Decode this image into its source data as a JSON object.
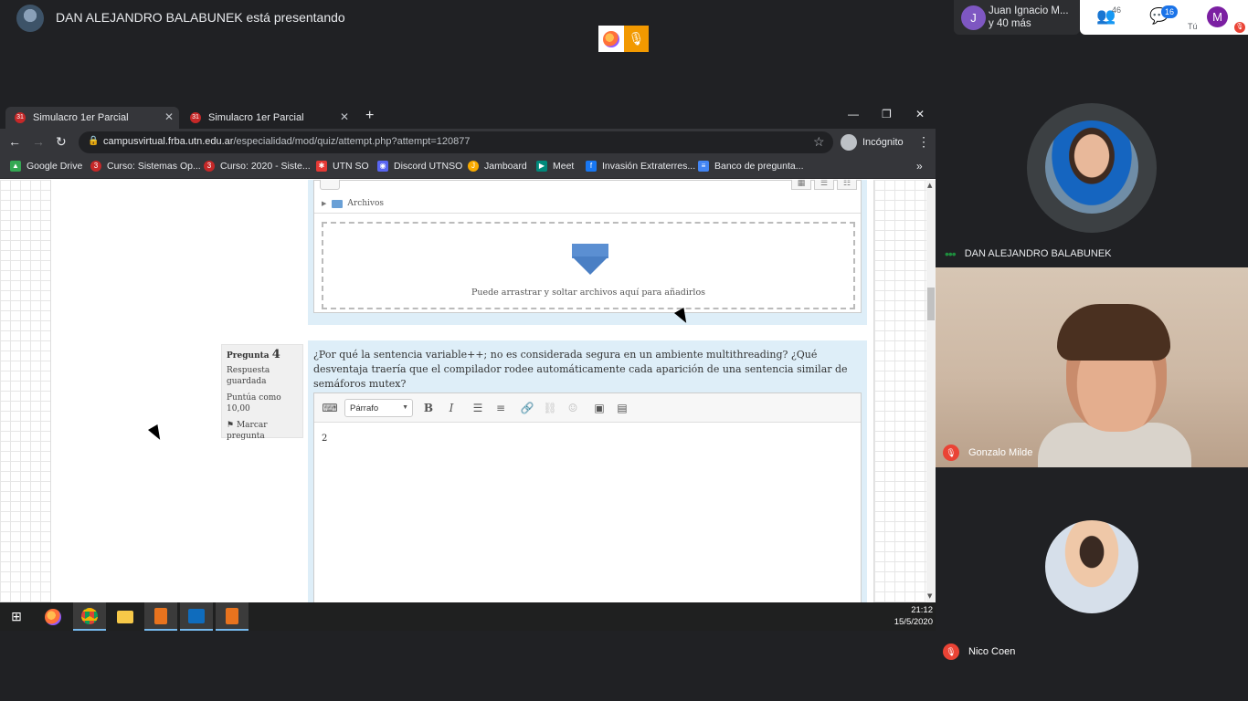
{
  "meet": {
    "presenter_text": "DAN ALEJANDRO BALABUNEK está presentando",
    "joined_avatar_initial": "J",
    "joined_line1": "Juan Ignacio M...",
    "joined_line2": "y 40 más",
    "people_count": "46",
    "chat_count": "16",
    "me_initial": "M",
    "me_label": "Tú",
    "icons": [
      "presentation-avatar",
      "firefox-icon",
      "microphone-icon",
      "people-icon",
      "chat-icon",
      "mute-icon"
    ]
  },
  "browser": {
    "tabs": [
      {
        "label": "Simulacro 1er Parcial",
        "active": true
      },
      {
        "label": "Simulacro 1er Parcial",
        "active": false
      }
    ],
    "url_host": "campusvirtual.frba.utn.edu.ar",
    "url_path": "/especialidad/mod/quiz/attempt.php?attempt=120877",
    "incognito_label": "Incógnito",
    "bookmarks": [
      {
        "label": "Google Drive",
        "color": "#34a853"
      },
      {
        "label": "Curso: Sistemas Op...",
        "color": "#c62828"
      },
      {
        "label": "Curso: 2020 - Siste...",
        "color": "#c62828"
      },
      {
        "label": "UTN SO",
        "color": "#e53935"
      },
      {
        "label": "Discord UTNSO",
        "color": "#5865f2"
      },
      {
        "label": "Jamboard",
        "color": "#f9ab00"
      },
      {
        "label": "Meet",
        "color": "#00897b"
      },
      {
        "label": "Invasión Extraterres...",
        "color": "#1877f2"
      },
      {
        "label": "Banco de pregunta...",
        "color": "#4285f4"
      }
    ]
  },
  "quiz": {
    "files_label": "Archivos",
    "dropzone_text": "Puede arrastrar y soltar archivos aquí para añadirlos",
    "q4": {
      "label": "Pregunta",
      "number": "4",
      "status": "Respuesta guardada",
      "score": "Puntúa como 10,00",
      "flag_label": "Marcar pregunta",
      "question": "¿Por qué la sentencia variable++; no es considerada segura en un ambiente multithreading? ¿Qué desventaja traería que el compilador rodee automáticamente cada aparición de una sentencia similar de semáforos mutex?",
      "format_select": "Párrafo",
      "answer_text": "2"
    }
  },
  "taskbar": {
    "time": "21:12",
    "date": "15/5/2020"
  },
  "participants": [
    {
      "name": "DAN ALEJANDRO BALABUNEK",
      "status": "speaking"
    },
    {
      "name": "Gonzalo Milde",
      "status": "muted"
    },
    {
      "name": "Nico Coen",
      "status": "muted"
    }
  ]
}
